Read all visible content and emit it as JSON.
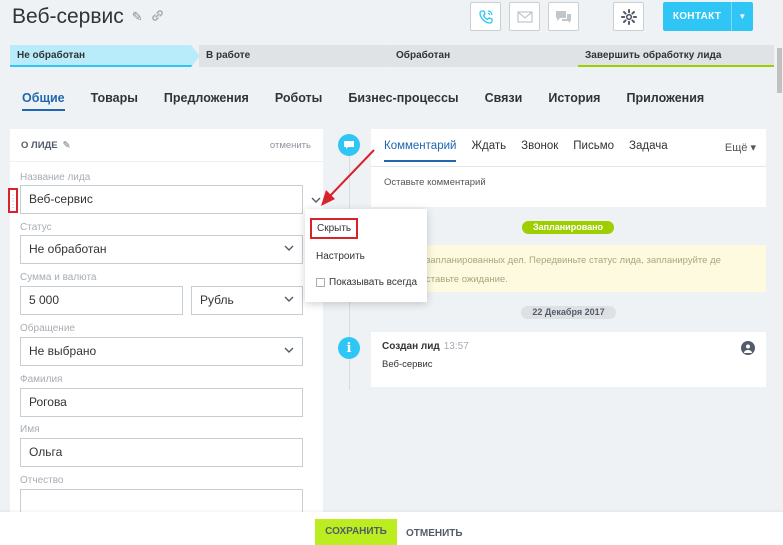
{
  "header": {
    "title": "Веб-сервис",
    "contact_label": "КОНТАКТ"
  },
  "stages": [
    "Не обработан",
    "В работе",
    "Обработан",
    "Завершить обработку лида"
  ],
  "tabs": [
    "Общие",
    "Товары",
    "Предложения",
    "Роботы",
    "Бизнес-процессы",
    "Связи",
    "История",
    "Приложения"
  ],
  "about": {
    "title": "О ЛИДЕ",
    "cancel": "отменить"
  },
  "fields": {
    "name_label": "Название лида",
    "name_value": "Веб-сервис",
    "status_label": "Статус",
    "status_value": "Не обработан",
    "amount_label": "Сумма и валюта",
    "amount_value": "5 000",
    "currency_value": "Рубль",
    "salutation_label": "Обращение",
    "salutation_value": "Не выбрано",
    "lastname_label": "Фамилия",
    "lastname_value": "Рогова",
    "firstname_label": "Имя",
    "firstname_value": "Ольга",
    "middlename_label": "Отчество",
    "middlename_value": ""
  },
  "popup": {
    "hide": "Скрыть",
    "configure": "Настроить",
    "always": "Показывать всегда"
  },
  "activity": {
    "tabs": [
      "Комментарий",
      "Ждать",
      "Звонок",
      "Письмо",
      "Задача"
    ],
    "more": "Ещё",
    "placeholder": "Оставьте комментарий",
    "planned_badge": "Запланировано",
    "planned_line1": "запланированных дел. Передвиньте статус лида, запланируйте де",
    "planned_line2": "ставьте ожидание.",
    "date_badge": "22 Декабря 2017",
    "event_title": "Создан лид",
    "event_time": "13:57",
    "event_sub": "Веб-сервис"
  },
  "footer": {
    "save": "СОХРАНИТЬ",
    "cancel": "ОТМЕНИТЬ"
  },
  "colors": {
    "accent": "#2fc6f6",
    "link": "#2067b0",
    "save": "#bbed21",
    "planned": "#9dcf00",
    "highlight": "#d9232c"
  }
}
